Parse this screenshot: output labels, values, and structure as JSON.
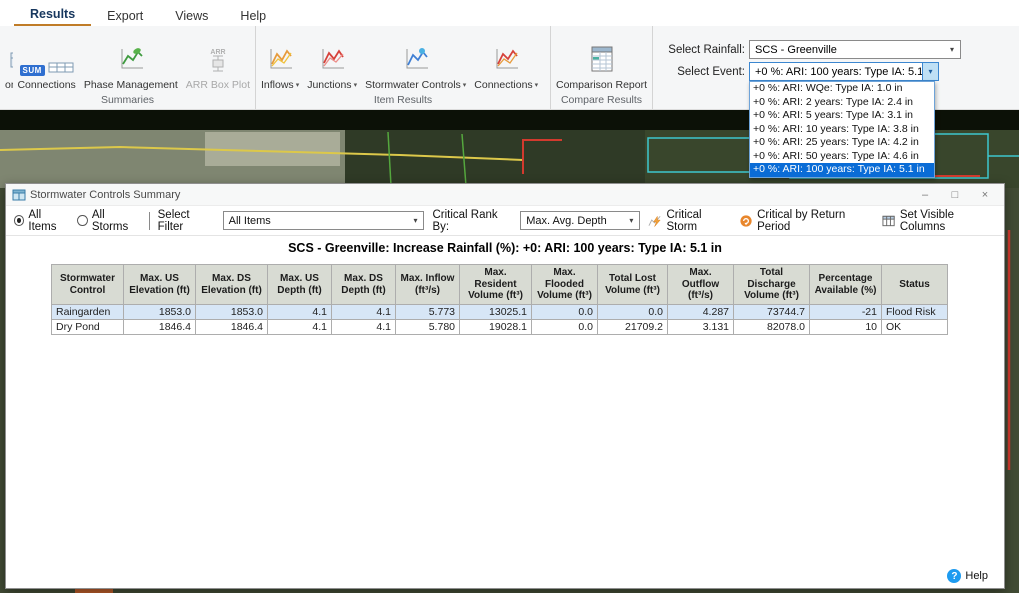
{
  "ribbon": {
    "tabs": [
      {
        "label": "Results"
      },
      {
        "label": "Export"
      },
      {
        "label": "Views"
      },
      {
        "label": "Help"
      }
    ],
    "groups": [
      {
        "label": "Summaries",
        "buttons": [
          {
            "label": "ontrols"
          },
          {
            "label": "Connections"
          },
          {
            "label": "Phase Management"
          },
          {
            "label": "ARR Box Plot",
            "disabled": true
          }
        ]
      },
      {
        "label": "Item Results",
        "buttons": [
          {
            "label": "Inflows"
          },
          {
            "label": "Junctions"
          },
          {
            "label": "Stormwater Controls"
          },
          {
            "label": "Connections"
          }
        ]
      },
      {
        "label": "Compare Results",
        "buttons": [
          {
            "label": "Comparison Report"
          }
        ]
      }
    ],
    "rainfall": {
      "label": "Select Rainfall:",
      "value": "SCS - Greenville"
    },
    "event": {
      "label": "Select Event:",
      "value": "+0 %: ARI: 100 years: Type IA: 5.1 in"
    },
    "event_options": [
      "+0 %: ARI: WQe: Type IA: 1.0 in",
      "+0 %: ARI: 2 years: Type IA: 2.4 in",
      "+0 %: ARI: 5 years: Type IA: 3.1 in",
      "+0 %: ARI: 10 years: Type IA: 3.8 in",
      "+0 %: ARI: 25 years: Type IA: 4.2 in",
      "+0 %: ARI: 50 years: Type IA: 4.6 in",
      "+0 %: ARI: 100 years: Type IA: 5.1 in"
    ],
    "event_selected_index": 6
  },
  "dialog": {
    "title": "Stormwater Controls Summary",
    "toolbar": {
      "all_items": "All Items",
      "all_storms": "All Storms",
      "select_filter_label": "Select Filter",
      "select_filter_value": "All Items",
      "critical_rank_label": "Critical Rank By:",
      "critical_rank_value": "Max. Avg. Depth",
      "critical_storm": "Critical Storm",
      "critical_by_return_period": "Critical by Return Period",
      "set_visible_columns": "Set Visible Columns"
    },
    "summary_title": "SCS - Greenville: Increase Rainfall (%): +0: ARI: 100 years: Type IA: 5.1 in",
    "table": {
      "headers": [
        "Stormwater Control",
        "Max. US Elevation (ft)",
        "Max. DS Elevation (ft)",
        "Max. US Depth (ft)",
        "Max. DS Depth (ft)",
        "Max. Inflow (ft³/s)",
        "Max. Resident Volume (ft³)",
        "Max. Flooded Volume (ft³)",
        "Total Lost Volume (ft³)",
        "Max. Outflow (ft³/s)",
        "Total Discharge Volume (ft³)",
        "Percentage Available (%)",
        "Status"
      ],
      "rows": [
        {
          "cells": [
            "Raingarden",
            "1853.0",
            "1853.0",
            "4.1",
            "4.1",
            "5.773",
            "13025.1",
            "0.0",
            "0.0",
            "4.287",
            "73744.7",
            "-21",
            "Flood Risk"
          ],
          "highlighted": true
        },
        {
          "cells": [
            "Dry Pond",
            "1846.4",
            "1846.4",
            "4.1",
            "4.1",
            "5.780",
            "19028.1",
            "0.0",
            "21709.2",
            "3.131",
            "82078.0",
            "10",
            "OK"
          ],
          "highlighted": false
        }
      ]
    },
    "help_label": "Help"
  },
  "colors": {
    "selection_blue": "#0a6cd6",
    "row_highlight": "#d7e6f6",
    "table_header_bg": "#d8dbd3",
    "active_tab_underline": "#c07c28",
    "help_icon_blue": "#1d9bf0"
  }
}
